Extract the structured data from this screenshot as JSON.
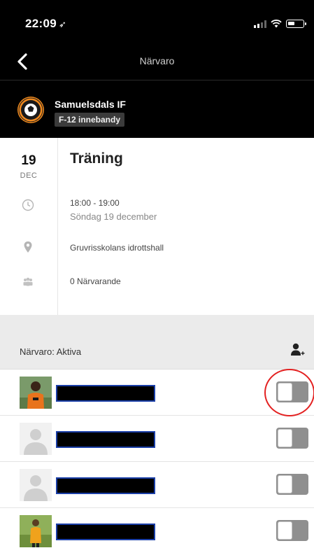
{
  "status_bar": {
    "time": "22:09",
    "location_glyph": "➶"
  },
  "nav": {
    "title": "Närvaro",
    "back_icon": "chevron-left-icon"
  },
  "team": {
    "name": "Samuelsdals IF",
    "badge": "F-12 innebandy"
  },
  "event": {
    "day": "19",
    "month": "DEC",
    "title": "Träning",
    "time_range": "18:00 - 19:00",
    "date_text": "Söndag 19 december",
    "location": "Gruvrisskolans idrottshall",
    "attendees": "0 Närvarande"
  },
  "attendance": {
    "header_label": "Närvaro: Aktiva",
    "rows": [
      {
        "avatar": "photo",
        "present": false
      },
      {
        "avatar": "placeholder",
        "present": false
      },
      {
        "avatar": "placeholder",
        "present": false
      },
      {
        "avatar": "photo",
        "present": false
      }
    ]
  },
  "colors": {
    "header_bg": "#000000",
    "toggle_track": "#8f8f8f",
    "highlight": "#e32121",
    "redact_border": "#1b3fa8"
  }
}
